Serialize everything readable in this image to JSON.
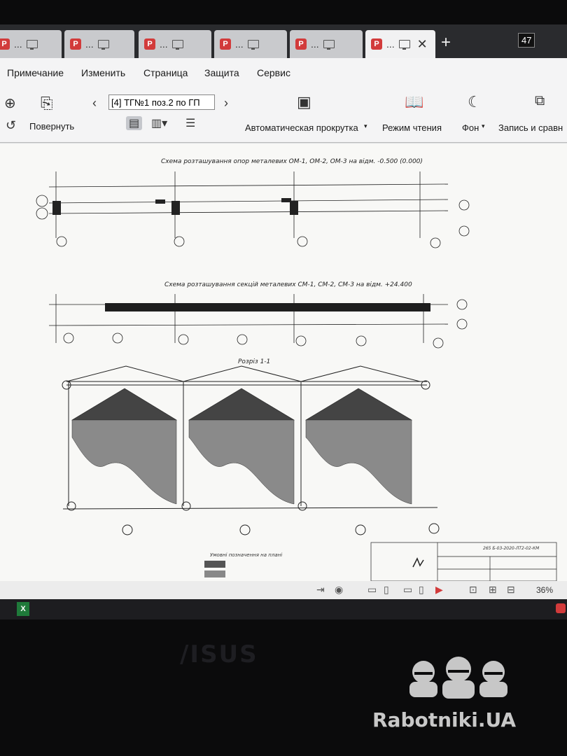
{
  "tabs": [
    {
      "label": "..."
    },
    {
      "label": "..."
    },
    {
      "label": "..."
    },
    {
      "label": "..."
    },
    {
      "label": "..."
    },
    {
      "label": "..."
    }
  ],
  "tab_count": "47",
  "menu": [
    "Примечание",
    "Изменить",
    "Страница",
    "Защита",
    "Сервис"
  ],
  "toolbar": {
    "rotate_label": "Повернуть",
    "page_field_value": "[4] ТГ№1 поз.2 по ГП",
    "autoscroll_label": "Автоматическая прокрутка",
    "reading_mode_label": "Режим чтения",
    "background_label": "Фон",
    "record_label": "Запись и сравн"
  },
  "drawing": {
    "title1": "Схема розташування опор металевих ОМ-1, ОМ-2, ОМ-3 на відм. -0.500 (0.000)",
    "title2": "Схема розташування секцій металевих СМ-1, СМ-2, СМ-3 на відм. +24.400",
    "title3": "Розріз 1-1",
    "legend_title": "Умовні позначення на плані",
    "stamp_code": "265 Б-03-2020-ЛТ2-02-КМ"
  },
  "status": {
    "zoom": "36%"
  },
  "monitor_brand": "/ISUS",
  "watermark": "Rabotniki.UA",
  "colors": {
    "accent": "#d23b3b",
    "tabbar": "#2a2b2e",
    "toolbar": "#f4f4f5"
  }
}
